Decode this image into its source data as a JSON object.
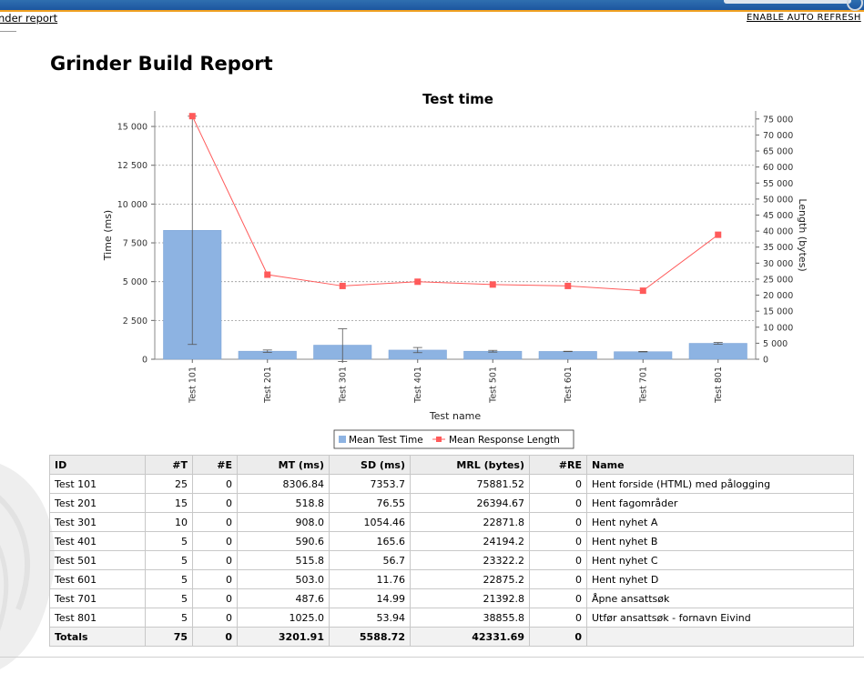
{
  "header": {
    "breadcrumb": "nder report",
    "refresh_link": "ENABLE AUTO REFRESH",
    "page_title": "Grinder Build Report"
  },
  "chart_data": {
    "type": "bar",
    "title": "Test time",
    "xlabel": "Test name",
    "ylabel": "Time (ms)",
    "y2label": "Length (bytes)",
    "categories": [
      "Test 101",
      "Test 201",
      "Test 301",
      "Test 401",
      "Test 501",
      "Test 601",
      "Test 701",
      "Test 801"
    ],
    "ylim": [
      0,
      16000
    ],
    "y2lim": [
      0,
      77500
    ],
    "yticks": [
      "0",
      "2 500",
      "5 000",
      "7 500",
      "10 000",
      "12 500",
      "15 000"
    ],
    "y2ticks": [
      "0",
      "5 000",
      "10 000",
      "15 000",
      "20 000",
      "25 000",
      "30 000",
      "35 000",
      "40 000",
      "45 000",
      "50 000",
      "55 000",
      "60 000",
      "65 000",
      "70 000",
      "75 000"
    ],
    "series": [
      {
        "name": "Mean Test Time",
        "kind": "bar",
        "axis": "left",
        "color": "#8db3e2",
        "values": [
          8306.84,
          518.8,
          908.0,
          590.6,
          515.8,
          503.0,
          487.6,
          1025.0
        ],
        "error": [
          7353.7,
          76.55,
          1054.46,
          165.6,
          56.7,
          11.76,
          14.99,
          53.94
        ]
      },
      {
        "name": "Mean Response Length",
        "kind": "line",
        "axis": "right",
        "color": "#ff5a5a",
        "values": [
          75881.52,
          26394.67,
          22871.8,
          24194.2,
          23322.2,
          22875.2,
          21392.8,
          38855.8
        ]
      }
    ],
    "grid": true,
    "legend_position": "bottom"
  },
  "table": {
    "headers": [
      "ID",
      "#T",
      "#E",
      "MT (ms)",
      "SD (ms)",
      "MRL (bytes)",
      "#RE",
      "Name"
    ],
    "rows": [
      [
        "Test 101",
        "25",
        "0",
        "8306.84",
        "7353.7",
        "75881.52",
        "0",
        "Hent forside (HTML) med pålogging"
      ],
      [
        "Test 201",
        "15",
        "0",
        "518.8",
        "76.55",
        "26394.67",
        "0",
        "Hent fagområder"
      ],
      [
        "Test 301",
        "10",
        "0",
        "908.0",
        "1054.46",
        "22871.8",
        "0",
        "Hent nyhet A"
      ],
      [
        "Test 401",
        "5",
        "0",
        "590.6",
        "165.6",
        "24194.2",
        "0",
        "Hent nyhet B"
      ],
      [
        "Test 501",
        "5",
        "0",
        "515.8",
        "56.7",
        "23322.2",
        "0",
        "Hent nyhet C"
      ],
      [
        "Test 601",
        "5",
        "0",
        "503.0",
        "11.76",
        "22875.2",
        "0",
        "Hent nyhet D"
      ],
      [
        "Test 701",
        "5",
        "0",
        "487.6",
        "14.99",
        "21392.8",
        "0",
        "Åpne ansattsøk"
      ],
      [
        "Test 801",
        "5",
        "0",
        "1025.0",
        "53.94",
        "38855.8",
        "0",
        "Utfør ansattsøk - fornavn Eivind"
      ]
    ],
    "totals": [
      "Totals",
      "75",
      "0",
      "3201.91",
      "5588.72",
      "42331.69",
      "0",
      ""
    ]
  }
}
